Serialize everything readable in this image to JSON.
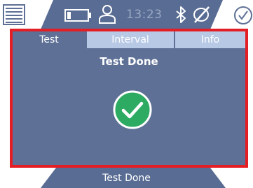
{
  "status": {
    "time": "13:23"
  },
  "tabs": [
    {
      "label": "Test",
      "active": true
    },
    {
      "label": "Interval",
      "active": false
    },
    {
      "label": "Info",
      "active": false
    }
  ],
  "panel": {
    "title": "Test Done"
  },
  "footer": {
    "label": "Test Done"
  },
  "colors": {
    "panel": "#5e7096",
    "status_band": "#596c93",
    "highlight_border": "#e31e24",
    "inactive_tab": "#b8c9e6",
    "success": "#2eab63"
  },
  "icons": [
    "menu-icon",
    "battery-icon",
    "user-icon",
    "bluetooth-icon",
    "gps-off-icon",
    "checkmark-icon",
    "success-check-icon"
  ]
}
